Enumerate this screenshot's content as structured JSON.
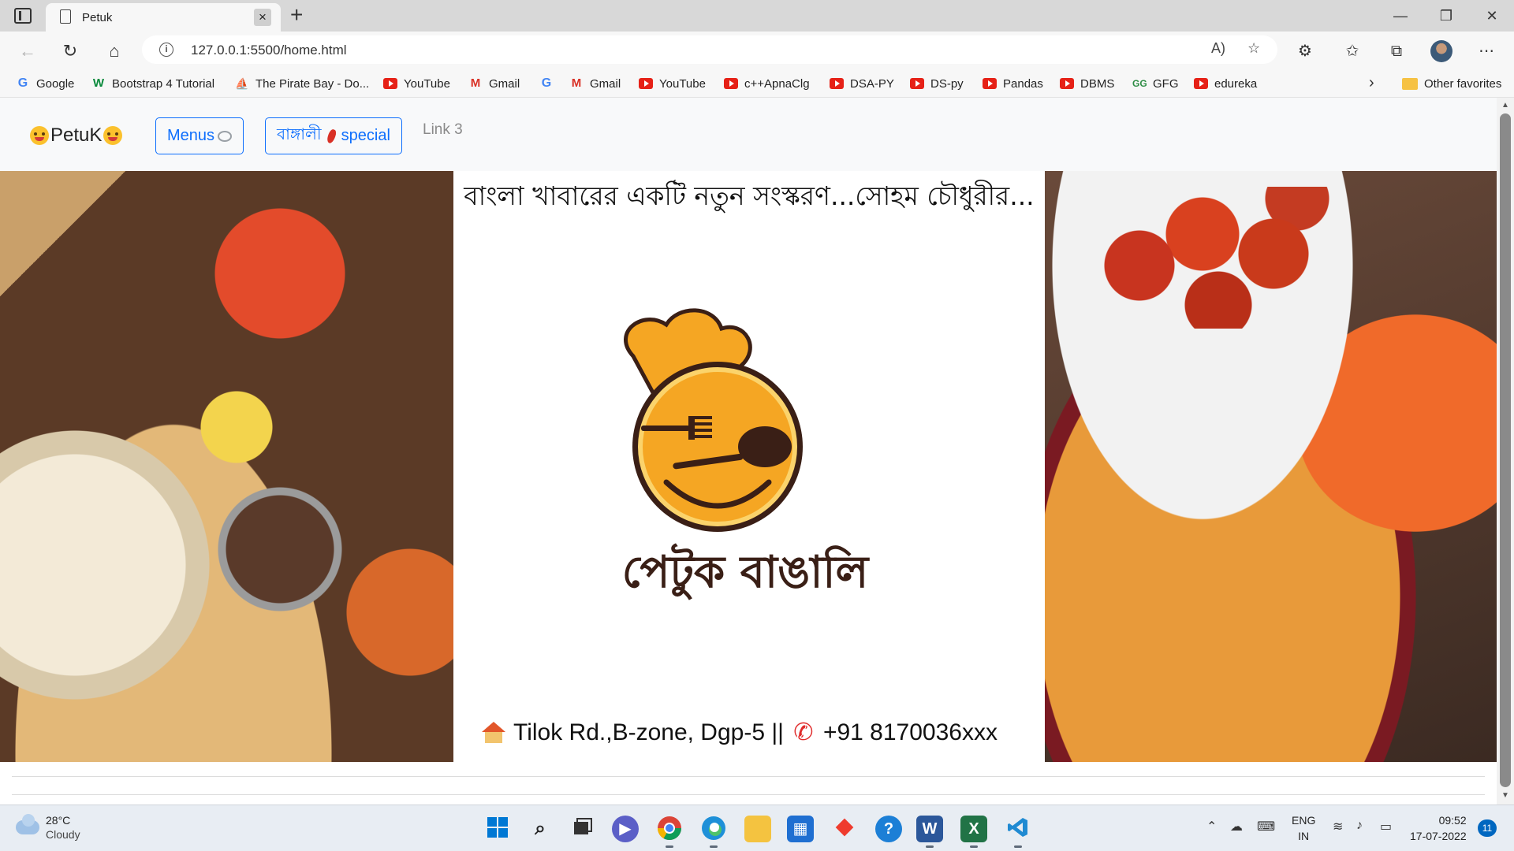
{
  "browser": {
    "tab_title": "Petuk",
    "url": "127.0.0.1:5500/home.html",
    "favorites": [
      {
        "label": "Google",
        "icon": "google-icon"
      },
      {
        "label": "Bootstrap 4 Tutorial",
        "icon": "w3schools-icon"
      },
      {
        "label": "The Pirate Bay - Do...",
        "icon": "pirate-ship-icon"
      },
      {
        "label": "YouTube",
        "icon": "youtube-icon"
      },
      {
        "label": "Gmail",
        "icon": "gmail-icon"
      },
      {
        "label": "",
        "icon": "google-icon"
      },
      {
        "label": "Gmail",
        "icon": "gmail-icon"
      },
      {
        "label": "YouTube",
        "icon": "youtube-icon"
      },
      {
        "label": "c++ApnaClg",
        "icon": "youtube-icon"
      },
      {
        "label": "DSA-PY",
        "icon": "youtube-icon"
      },
      {
        "label": "DS-py",
        "icon": "youtube-icon"
      },
      {
        "label": "Pandas",
        "icon": "youtube-icon"
      },
      {
        "label": "DBMS",
        "icon": "youtube-icon"
      },
      {
        "label": "GFG",
        "icon": "gfg-icon"
      },
      {
        "label": "edureka",
        "icon": "youtube-icon"
      }
    ],
    "other_favorites": "Other favorites"
  },
  "page": {
    "brand": "PetuK",
    "nav": {
      "menus": "Menus",
      "special_bangla": "বাঙ্গালী",
      "special_word": "special",
      "link3": "Link 3"
    },
    "tagline": "বাংলা খাবারের একটি নতুন সংস্করণ...সোহম চৌধুরীর...",
    "logo_text": "পেটুক বাঙালি",
    "address": "Tilok Rd.,B-zone, Dgp-5 ||",
    "phone": "+91 8170036xxx"
  },
  "taskbar": {
    "temperature": "28°C",
    "condition": "Cloudy",
    "lang_top": "ENG",
    "lang_bottom": "IN",
    "time": "09:52",
    "date": "17-07-2022",
    "notifications": "11"
  },
  "colors": {
    "accent": "#0d6efd",
    "logo_orange": "#f5a623",
    "logo_dark": "#3a1f16",
    "taskbar_bg": "#e8edf3"
  }
}
